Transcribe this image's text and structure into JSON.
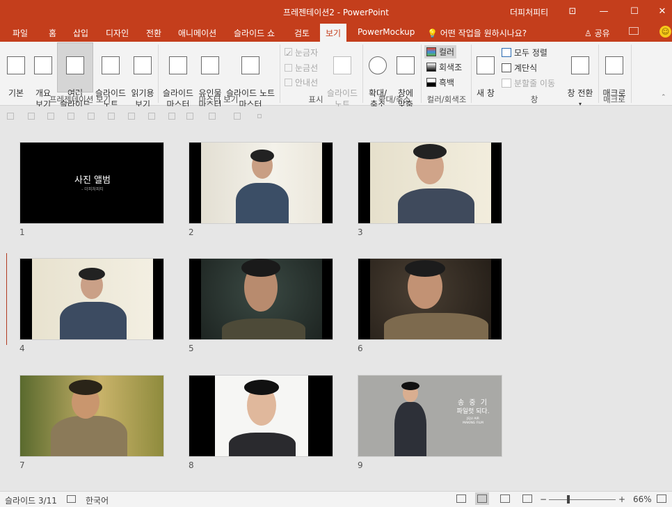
{
  "title_bar": {
    "title": "프레젠테이션2 - PowerPoint",
    "user": "더피처피티",
    "buttons": {
      "ribbon_display": "⊡",
      "minimize": "—",
      "maximize": "☐",
      "close": "✕"
    }
  },
  "tabs": {
    "items": [
      "파일",
      "홈",
      "삽입",
      "디자인",
      "전환",
      "애니메이션",
      "슬라이드 쇼",
      "검토",
      "보기",
      "PowerMockup"
    ],
    "active": "보기",
    "tell_me": "어떤 작업을 원하시나요?",
    "share": "공유"
  },
  "ribbon": {
    "presentation_views": {
      "label": "프레젠테이션 보기",
      "buttons": [
        "기본",
        "개요\n보기",
        "여러\n슬라이드",
        "슬라이드\n노트",
        "읽기용\n보기"
      ],
      "selected": "여러\n슬라이드"
    },
    "master_views": {
      "label": "마스터 보기",
      "buttons": [
        "슬라이드\n마스터",
        "유인물\n마스터",
        "슬라이드 노트\n마스터"
      ]
    },
    "show": {
      "label": "표시",
      "checkboxes": [
        {
          "label": "눈금자",
          "checked": true
        },
        {
          "label": "눈금선",
          "checked": false
        },
        {
          "label": "안내선",
          "checked": false
        }
      ],
      "notes_button": "슬라이드\n노트"
    },
    "zoom": {
      "label": "확대/축소",
      "buttons": [
        "확대/\n축소",
        "창에\n맞춤"
      ]
    },
    "color": {
      "label": "컬러/회색조",
      "items": [
        "컬러",
        "회색조",
        "흑백"
      ],
      "selected": "컬러"
    },
    "window": {
      "label": "창",
      "new_window": "새 창",
      "items": [
        "모두 정렬",
        "계단식",
        "분할줄 이동"
      ],
      "switch_windows": "창 전환"
    },
    "macros": {
      "label": "매크로",
      "button": "매크로"
    }
  },
  "slides": [
    {
      "number": "1",
      "title": "사진 앨범",
      "subtitle": "- 더피처피티"
    },
    {
      "number": "2"
    },
    {
      "number": "3"
    },
    {
      "number": "4"
    },
    {
      "number": "5"
    },
    {
      "number": "6"
    },
    {
      "number": "7"
    },
    {
      "number": "8"
    },
    {
      "number": "9",
      "headline": "송 중 기",
      "tagline": "파일럿 되다.",
      "small_text": "JEJU AIR\nMAKING FILM"
    }
  ],
  "status_bar": {
    "slide_position": "슬라이드 3/11",
    "language": "한국어",
    "zoom_percent": "66%"
  },
  "colors": {
    "accent": "#c43e1c",
    "ribbon_bg": "#f3f3f3",
    "sorter_bg": "#e6e6e6"
  }
}
